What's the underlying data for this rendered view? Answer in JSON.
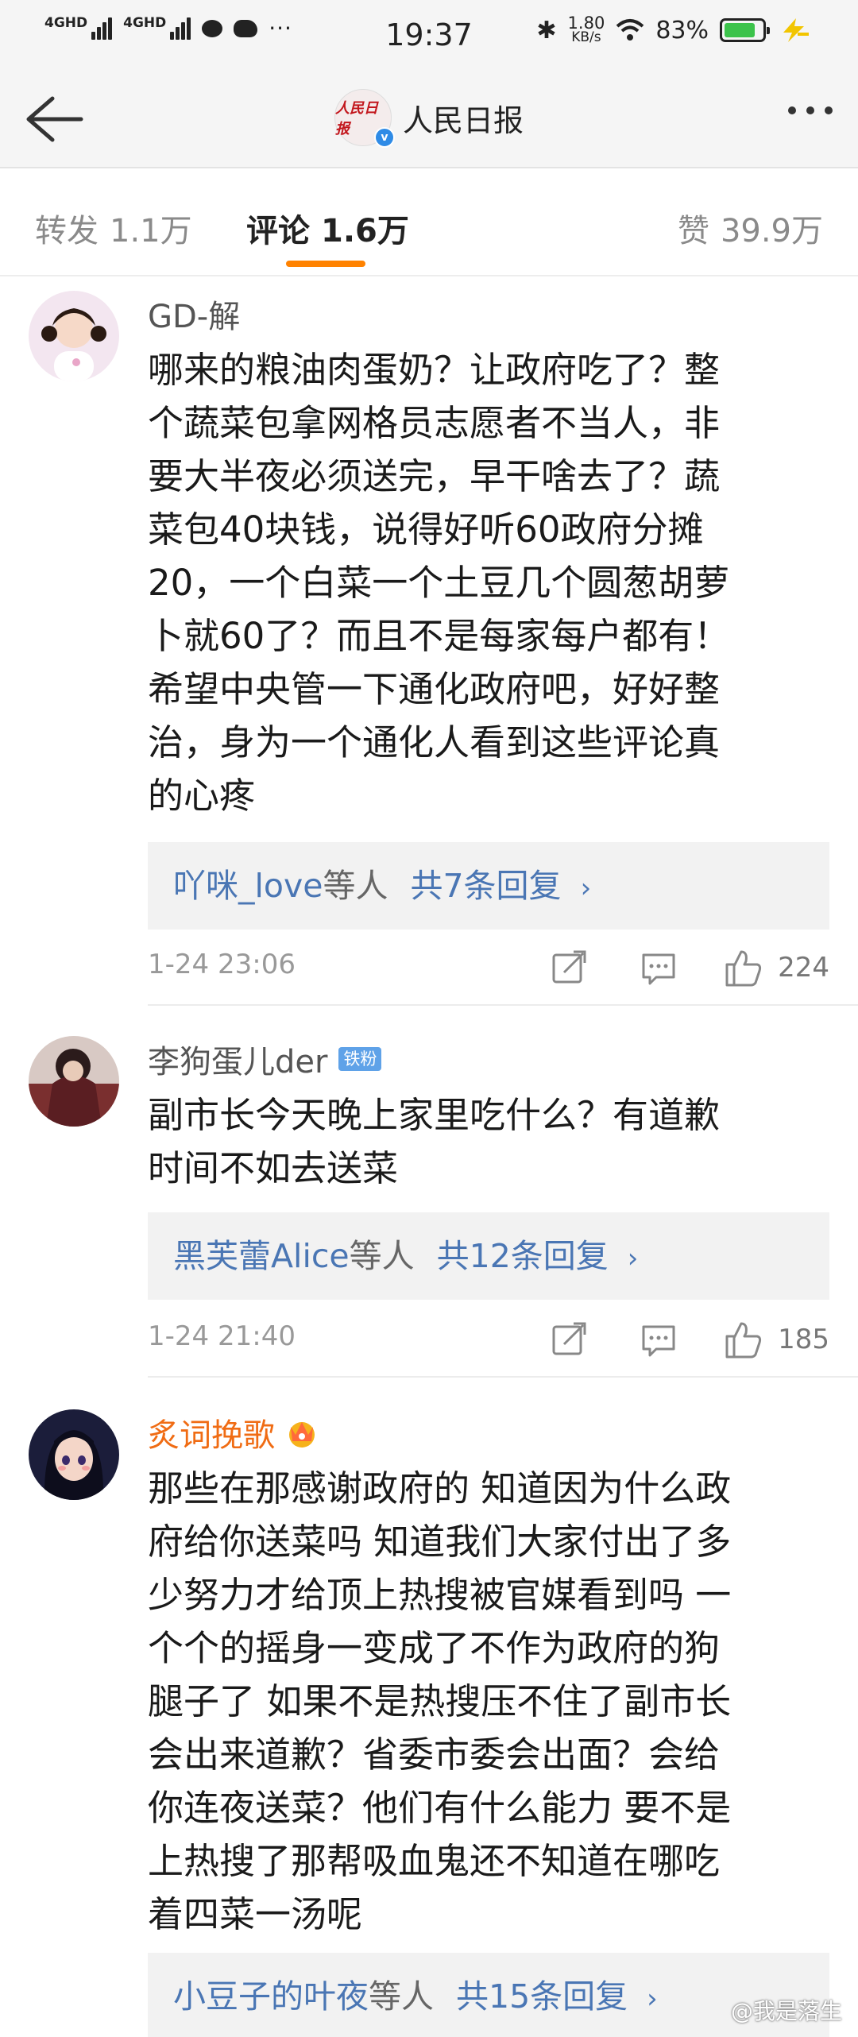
{
  "status_bar": {
    "signal1": "4GHD",
    "signal2": "4GHD",
    "more": "···",
    "time": "19:37",
    "speed": "1.80",
    "speed_unit": "KB/s",
    "battery_pct": "83%",
    "battery_level": 0.83,
    "battery_color": "#3cc34b"
  },
  "nav": {
    "title": "人民日报",
    "avatar_text": "人民日报"
  },
  "tabs": [
    {
      "label": "转发",
      "count": "1.1万"
    },
    {
      "label": "评论",
      "count": "1.6万"
    },
    {
      "label": "赞",
      "count": "39.9万"
    }
  ],
  "accent_color": "#ff8200",
  "comments": [
    {
      "user": "GD-解",
      "lines": [
        "哪来的粮油肉蛋奶？让政府吃了？整",
        "个蔬菜包拿网格员志愿者不当人，非",
        "要大半夜必须送完，早干啥去了？蔬",
        "菜包40块钱，说得好听60政府分摊",
        "20，一个白菜一个土豆几个圆葱胡萝",
        "卜就60了？而且不是每家每户都有！",
        "希望中央管一下通化政府吧，好好整",
        "治，身为一个通化人看到这些评论真",
        "的心疼"
      ],
      "reply_name": "吖咪_love",
      "reply_mid": "等人",
      "reply_count": "共7条回复",
      "time": "1-24 23:06",
      "likes": "224"
    },
    {
      "user": "李狗蛋儿der",
      "badge": "铁粉",
      "lines": [
        "副市长今天晚上家里吃什么？有道歉",
        "时间不如去送菜"
      ],
      "reply_name": "黑芙蕾Alice",
      "reply_mid": "等人",
      "reply_count": "共12条回复",
      "time": "1-24 21:40",
      "likes": "185"
    },
    {
      "user": "炙词挽歌",
      "lines": [
        "那些在那感谢政府的 知道因为什么政",
        "府给你送菜吗 知道我们大家付出了多",
        "少努力才给顶上热搜被官媒看到吗 一",
        "个个的摇身一变成了不作为政府的狗",
        "腿子了 如果不是热搜压不住了副市长",
        "会出来道歉？省委市委会出面？会给",
        "你连夜送菜？他们有什么能力 要不是",
        "上热搜了那帮吸血鬼还不知道在哪吃",
        "着四菜一汤呢"
      ],
      "reply_name": "小豆子的叶夜",
      "reply_mid": "等人",
      "reply_count": "共15条回复",
      "time": "",
      "likes": ""
    }
  ],
  "reply_chevron": "›",
  "watermark": "@我是落生"
}
